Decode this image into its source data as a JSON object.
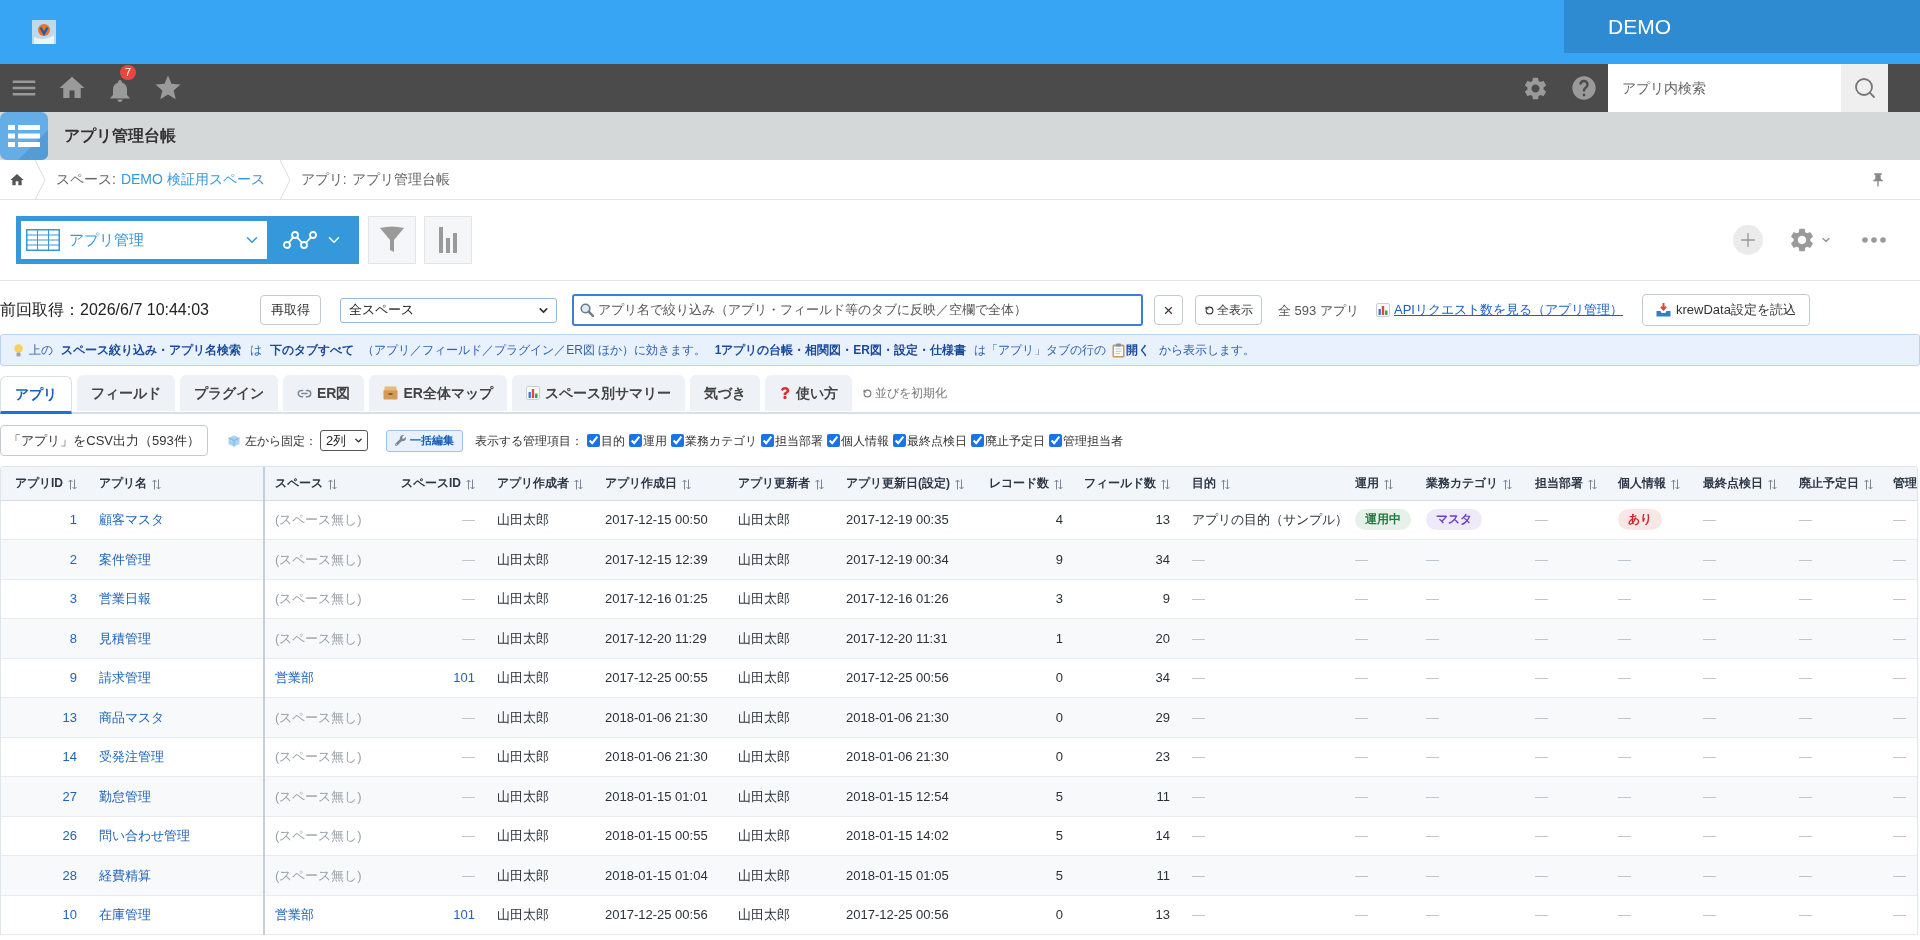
{
  "header": {
    "brand": "DEMO"
  },
  "nav": {
    "notification_count": "7",
    "search": {
      "placeholder": "アプリ内検索"
    }
  },
  "title_bar": {
    "title": "アプリ管理台帳"
  },
  "breadcrumb": [
    {
      "prefix": "スペース:",
      "text": "DEMO 検証用スペース",
      "link": true
    },
    {
      "prefix": "アプリ:",
      "text": "アプリ管理台帳",
      "link": false
    }
  ],
  "view_selector": {
    "value": "アプリ管理"
  },
  "filter_bar": {
    "last_fetched": "前回取得：2026/6/7 10:44:03",
    "refetch_button": "再取得",
    "space_select": "全スペース",
    "search": {
      "placeholder": "アプリ名で絞り込み（アプリ・フィールド等のタブに反映／空欄で全体）"
    },
    "clear_button": "×",
    "show_all_button": "全表示",
    "count": "全 593 アプリ",
    "api_link": "APIリクエスト数を見る（アプリ管理）",
    "krewdata_button": "krewData設定を読込"
  },
  "info_banner": [
    "上の **スペース絞り込み・アプリ名検索** は **下のタブすべて** （アプリ／フィールド／プラグイン／ER図 ほか）に効きます。 **1アプリの台帳・相関図・ER図・設定・仕様書** は「アプリ」タブの行の",
    "**開く** から表示します。"
  ],
  "tabs": [
    {
      "label": "アプリ",
      "selected": true
    },
    {
      "label": "フィールド",
      "selected": false
    },
    {
      "label": "プラグイン",
      "selected": false
    },
    {
      "label": "ER図",
      "selected": false
    },
    {
      "label": "ER全体マップ",
      "selected": false
    },
    {
      "label": "スペース別サマリー",
      "selected": false
    },
    {
      "label": "気づき",
      "selected": false
    },
    {
      "label": "使い方",
      "selected": false
    }
  ],
  "reset_order_link": "並びを初期化",
  "table_controls": {
    "csv_button": "「アプリ」をCSV出力（593件）",
    "pin_label": "左から固定：",
    "pin_select": "2列",
    "bulk_edit_button": "一括編集",
    "columns_label": "表示する管理項目：",
    "column_toggles": [
      {
        "label": "目的",
        "checked": true
      },
      {
        "label": "運用",
        "checked": true
      },
      {
        "label": "業務カテゴリ",
        "checked": true
      },
      {
        "label": "担当部署",
        "checked": true
      },
      {
        "label": "個人情報",
        "checked": true
      },
      {
        "label": "最終点検日",
        "checked": true
      },
      {
        "label": "廃止予定日",
        "checked": true
      },
      {
        "label": "管理担当者",
        "checked": true
      }
    ]
  },
  "table": {
    "columns": [
      {
        "label": "アプリID",
        "sort_icon": true
      },
      {
        "label": "アプリ名",
        "sort_icon": true
      },
      {
        "label": "スペース",
        "sort_icon": true
      },
      {
        "label": "スペースID",
        "sort_icon": true
      },
      {
        "label": "アプリ作成者",
        "sort_icon": true
      },
      {
        "label": "アプリ作成日",
        "sort_icon": true
      },
      {
        "label": "アプリ更新者",
        "sort_icon": true
      },
      {
        "label": "アプリ更新日(設定)",
        "sort_icon": true
      },
      {
        "label": "レコード数",
        "sort_icon": true
      },
      {
        "label": "フィールド数",
        "sort_icon": true
      },
      {
        "label": "目的",
        "sort_icon": true
      },
      {
        "label": "運用",
        "sort_icon": true
      },
      {
        "label": "業務カテゴリ",
        "sort_icon": true
      },
      {
        "label": "担当部署",
        "sort_icon": true
      },
      {
        "label": "個人情報",
        "sort_icon": true
      },
      {
        "label": "最終点検日",
        "sort_icon": true
      },
      {
        "label": "廃止予定日",
        "sort_icon": true
      },
      {
        "label": "管理",
        "sort_icon": false
      }
    ],
    "rows": [
      {
        "cells": [
          {
            "text": "1",
            "kind": "link"
          },
          {
            "text": "顧客マスタ",
            "kind": "link"
          },
          {
            "text": "(スペース無し)",
            "kind": "muted"
          },
          {
            "text": "—",
            "kind": "dash"
          },
          {
            "text": "山田太郎",
            "kind": "text"
          },
          {
            "text": "2017-12-15 00:50",
            "kind": "text"
          },
          {
            "text": "山田太郎",
            "kind": "text"
          },
          {
            "text": "2017-12-19 00:35",
            "kind": "text"
          },
          {
            "text": "4",
            "kind": "text"
          },
          {
            "text": "13",
            "kind": "text"
          },
          {
            "text": "アプリの目的（サンプル）",
            "kind": "text"
          },
          {
            "text": "運用中",
            "kind": "badge",
            "color": "#1e7b3c"
          },
          {
            "text": "マスタ",
            "kind": "badge",
            "color": "#6b3fc4"
          },
          {
            "text": "—",
            "kind": "dash"
          },
          {
            "text": "あり",
            "kind": "badge",
            "color": "#c62828"
          },
          {
            "text": "—",
            "kind": "dash"
          },
          {
            "text": "—",
            "kind": "dash"
          },
          {
            "text": "—",
            "kind": "dash"
          }
        ]
      },
      {
        "cells": [
          {
            "text": "2",
            "kind": "link"
          },
          {
            "text": "案件管理",
            "kind": "link"
          },
          {
            "text": "(スペース無し)",
            "kind": "muted"
          },
          {
            "text": "—",
            "kind": "dash"
          },
          {
            "text": "山田太郎",
            "kind": "text"
          },
          {
            "text": "2017-12-15 12:39",
            "kind": "text"
          },
          {
            "text": "山田太郎",
            "kind": "text"
          },
          {
            "text": "2017-12-19 00:34",
            "kind": "text"
          },
          {
            "text": "9",
            "kind": "text"
          },
          {
            "text": "34",
            "kind": "text"
          },
          {
            "text": "—",
            "kind": "dash"
          },
          {
            "text": "—",
            "kind": "dash"
          },
          {
            "text": "—",
            "kind": "dash"
          },
          {
            "text": "—",
            "kind": "dash"
          },
          {
            "text": "—",
            "kind": "dash"
          },
          {
            "text": "—",
            "kind": "dash"
          },
          {
            "text": "—",
            "kind": "dash"
          },
          {
            "text": "—",
            "kind": "dash"
          }
        ]
      },
      {
        "cells": [
          {
            "text": "3",
            "kind": "link"
          },
          {
            "text": "営業日報",
            "kind": "link"
          },
          {
            "text": "(スペース無し)",
            "kind": "muted"
          },
          {
            "text": "—",
            "kind": "dash"
          },
          {
            "text": "山田太郎",
            "kind": "text"
          },
          {
            "text": "2017-12-16 01:25",
            "kind": "text"
          },
          {
            "text": "山田太郎",
            "kind": "text"
          },
          {
            "text": "2017-12-16 01:26",
            "kind": "text"
          },
          {
            "text": "3",
            "kind": "text"
          },
          {
            "text": "9",
            "kind": "text"
          },
          {
            "text": "—",
            "kind": "dash"
          },
          {
            "text": "—",
            "kind": "dash"
          },
          {
            "text": "—",
            "kind": "dash"
          },
          {
            "text": "—",
            "kind": "dash"
          },
          {
            "text": "—",
            "kind": "dash"
          },
          {
            "text": "—",
            "kind": "dash"
          },
          {
            "text": "—",
            "kind": "dash"
          },
          {
            "text": "—",
            "kind": "dash"
          }
        ]
      },
      {
        "cells": [
          {
            "text": "8",
            "kind": "link"
          },
          {
            "text": "見積管理",
            "kind": "link"
          },
          {
            "text": "(スペース無し)",
            "kind": "muted"
          },
          {
            "text": "—",
            "kind": "dash"
          },
          {
            "text": "山田太郎",
            "kind": "text"
          },
          {
            "text": "2017-12-20 11:29",
            "kind": "text"
          },
          {
            "text": "山田太郎",
            "kind": "text"
          },
          {
            "text": "2017-12-20 11:31",
            "kind": "text"
          },
          {
            "text": "1",
            "kind": "text"
          },
          {
            "text": "20",
            "kind": "text"
          },
          {
            "text": "—",
            "kind": "dash"
          },
          {
            "text": "—",
            "kind": "dash"
          },
          {
            "text": "—",
            "kind": "dash"
          },
          {
            "text": "—",
            "kind": "dash"
          },
          {
            "text": "—",
            "kind": "dash"
          },
          {
            "text": "—",
            "kind": "dash"
          },
          {
            "text": "—",
            "kind": "dash"
          },
          {
            "text": "—",
            "kind": "dash"
          }
        ]
      },
      {
        "cells": [
          {
            "text": "9",
            "kind": "link"
          },
          {
            "text": "請求管理",
            "kind": "link"
          },
          {
            "text": "営業部",
            "kind": "link"
          },
          {
            "text": "101",
            "kind": "link"
          },
          {
            "text": "山田太郎",
            "kind": "text"
          },
          {
            "text": "2017-12-25 00:55",
            "kind": "text"
          },
          {
            "text": "山田太郎",
            "kind": "text"
          },
          {
            "text": "2017-12-25 00:56",
            "kind": "text"
          },
          {
            "text": "0",
            "kind": "text"
          },
          {
            "text": "34",
            "kind": "text"
          },
          {
            "text": "—",
            "kind": "dash"
          },
          {
            "text": "—",
            "kind": "dash"
          },
          {
            "text": "—",
            "kind": "dash"
          },
          {
            "text": "—",
            "kind": "dash"
          },
          {
            "text": "—",
            "kind": "dash"
          },
          {
            "text": "—",
            "kind": "dash"
          },
          {
            "text": "—",
            "kind": "dash"
          },
          {
            "text": "—",
            "kind": "dash"
          }
        ]
      },
      {
        "cells": [
          {
            "text": "13",
            "kind": "link"
          },
          {
            "text": "商品マスタ",
            "kind": "link"
          },
          {
            "text": "(スペース無し)",
            "kind": "muted"
          },
          {
            "text": "—",
            "kind": "dash"
          },
          {
            "text": "山田太郎",
            "kind": "text"
          },
          {
            "text": "2018-01-06 21:30",
            "kind": "text"
          },
          {
            "text": "山田太郎",
            "kind": "text"
          },
          {
            "text": "2018-01-06 21:30",
            "kind": "text"
          },
          {
            "text": "0",
            "kind": "text"
          },
          {
            "text": "29",
            "kind": "text"
          },
          {
            "text": "—",
            "kind": "dash"
          },
          {
            "text": "—",
            "kind": "dash"
          },
          {
            "text": "—",
            "kind": "dash"
          },
          {
            "text": "—",
            "kind": "dash"
          },
          {
            "text": "—",
            "kind": "dash"
          },
          {
            "text": "—",
            "kind": "dash"
          },
          {
            "text": "—",
            "kind": "dash"
          },
          {
            "text": "—",
            "kind": "dash"
          }
        ]
      },
      {
        "cells": [
          {
            "text": "14",
            "kind": "link"
          },
          {
            "text": "受発注管理",
            "kind": "link"
          },
          {
            "text": "(スペース無し)",
            "kind": "muted"
          },
          {
            "text": "—",
            "kind": "dash"
          },
          {
            "text": "山田太郎",
            "kind": "text"
          },
          {
            "text": "2018-01-06 21:30",
            "kind": "text"
          },
          {
            "text": "山田太郎",
            "kind": "text"
          },
          {
            "text": "2018-01-06 21:30",
            "kind": "text"
          },
          {
            "text": "0",
            "kind": "text"
          },
          {
            "text": "23",
            "kind": "text"
          },
          {
            "text": "—",
            "kind": "dash"
          },
          {
            "text": "—",
            "kind": "dash"
          },
          {
            "text": "—",
            "kind": "dash"
          },
          {
            "text": "—",
            "kind": "dash"
          },
          {
            "text": "—",
            "kind": "dash"
          },
          {
            "text": "—",
            "kind": "dash"
          },
          {
            "text": "—",
            "kind": "dash"
          },
          {
            "text": "—",
            "kind": "dash"
          }
        ]
      },
      {
        "cells": [
          {
            "text": "27",
            "kind": "link"
          },
          {
            "text": "勤怠管理",
            "kind": "link"
          },
          {
            "text": "(スペース無し)",
            "kind": "muted"
          },
          {
            "text": "—",
            "kind": "dash"
          },
          {
            "text": "山田太郎",
            "kind": "text"
          },
          {
            "text": "2018-01-15 01:01",
            "kind": "text"
          },
          {
            "text": "山田太郎",
            "kind": "text"
          },
          {
            "text": "2018-01-15 12:54",
            "kind": "text"
          },
          {
            "text": "5",
            "kind": "text"
          },
          {
            "text": "11",
            "kind": "text"
          },
          {
            "text": "—",
            "kind": "dash"
          },
          {
            "text": "—",
            "kind": "dash"
          },
          {
            "text": "—",
            "kind": "dash"
          },
          {
            "text": "—",
            "kind": "dash"
          },
          {
            "text": "—",
            "kind": "dash"
          },
          {
            "text": "—",
            "kind": "dash"
          },
          {
            "text": "—",
            "kind": "dash"
          },
          {
            "text": "—",
            "kind": "dash"
          }
        ]
      },
      {
        "cells": [
          {
            "text": "26",
            "kind": "link"
          },
          {
            "text": "問い合わせ管理",
            "kind": "link"
          },
          {
            "text": "(スペース無し)",
            "kind": "muted"
          },
          {
            "text": "—",
            "kind": "dash"
          },
          {
            "text": "山田太郎",
            "kind": "text"
          },
          {
            "text": "2018-01-15 00:55",
            "kind": "text"
          },
          {
            "text": "山田太郎",
            "kind": "text"
          },
          {
            "text": "2018-01-15 14:02",
            "kind": "text"
          },
          {
            "text": "5",
            "kind": "text"
          },
          {
            "text": "14",
            "kind": "text"
          },
          {
            "text": "—",
            "kind": "dash"
          },
          {
            "text": "—",
            "kind": "dash"
          },
          {
            "text": "—",
            "kind": "dash"
          },
          {
            "text": "—",
            "kind": "dash"
          },
          {
            "text": "—",
            "kind": "dash"
          },
          {
            "text": "—",
            "kind": "dash"
          },
          {
            "text": "—",
            "kind": "dash"
          },
          {
            "text": "—",
            "kind": "dash"
          }
        ]
      },
      {
        "cells": [
          {
            "text": "28",
            "kind": "link"
          },
          {
            "text": "経費精算",
            "kind": "link"
          },
          {
            "text": "(スペース無し)",
            "kind": "muted"
          },
          {
            "text": "—",
            "kind": "dash"
          },
          {
            "text": "山田太郎",
            "kind": "text"
          },
          {
            "text": "2018-01-15 01:04",
            "kind": "text"
          },
          {
            "text": "山田太郎",
            "kind": "text"
          },
          {
            "text": "2018-01-15 01:05",
            "kind": "text"
          },
          {
            "text": "5",
            "kind": "text"
          },
          {
            "text": "11",
            "kind": "text"
          },
          {
            "text": "—",
            "kind": "dash"
          },
          {
            "text": "—",
            "kind": "dash"
          },
          {
            "text": "—",
            "kind": "dash"
          },
          {
            "text": "—",
            "kind": "dash"
          },
          {
            "text": "—",
            "kind": "dash"
          },
          {
            "text": "—",
            "kind": "dash"
          },
          {
            "text": "—",
            "kind": "dash"
          },
          {
            "text": "—",
            "kind": "dash"
          }
        ]
      },
      {
        "cells": [
          {
            "text": "10",
            "kind": "link"
          },
          {
            "text": "在庫管理",
            "kind": "link"
          },
          {
            "text": "営業部",
            "kind": "link"
          },
          {
            "text": "101",
            "kind": "link"
          },
          {
            "text": "山田太郎",
            "kind": "text"
          },
          {
            "text": "2017-12-25 00:56",
            "kind": "text"
          },
          {
            "text": "山田太郎",
            "kind": "text"
          },
          {
            "text": "2017-12-25 00:56",
            "kind": "text"
          },
          {
            "text": "0",
            "kind": "text"
          },
          {
            "text": "13",
            "kind": "text"
          },
          {
            "text": "—",
            "kind": "dash"
          },
          {
            "text": "—",
            "kind": "dash"
          },
          {
            "text": "—",
            "kind": "dash"
          },
          {
            "text": "—",
            "kind": "dash"
          },
          {
            "text": "—",
            "kind": "dash"
          },
          {
            "text": "—",
            "kind": "dash"
          },
          {
            "text": "—",
            "kind": "dash"
          },
          {
            "text": "—",
            "kind": "dash"
          }
        ]
      }
    ]
  }
}
